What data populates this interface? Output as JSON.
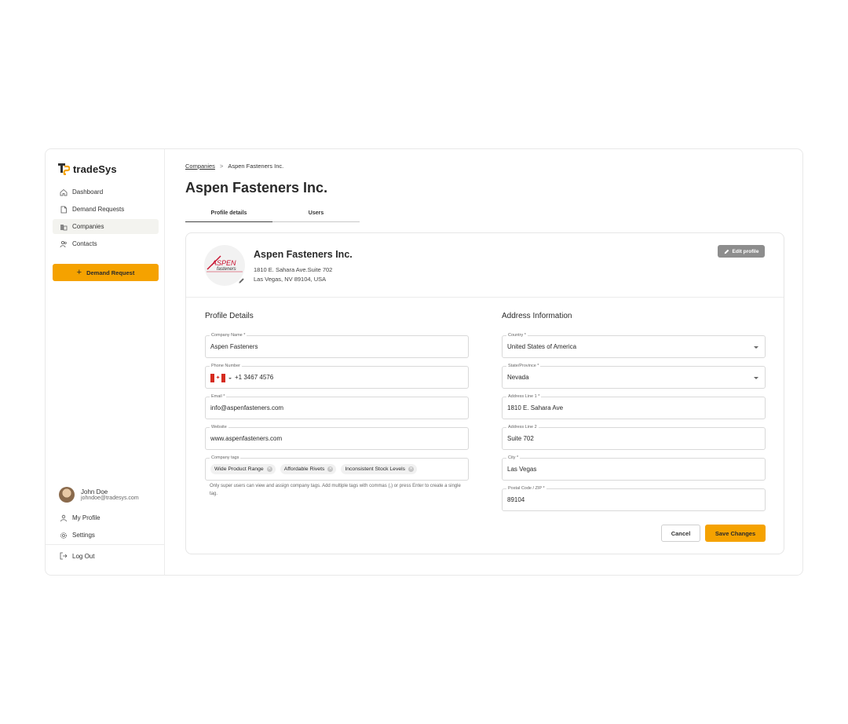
{
  "brand": {
    "name": "tradeSys",
    "accent": "#f5a200"
  },
  "sidebar": {
    "items": [
      {
        "label": "Dashboard",
        "icon": "home-icon"
      },
      {
        "label": "Demand Requests",
        "icon": "document-icon"
      },
      {
        "label": "Companies",
        "icon": "building-icon",
        "active": true
      },
      {
        "label": "Contacts",
        "icon": "users-icon"
      }
    ],
    "demand_button": "Demand Request",
    "user": {
      "name": "John Doe",
      "email": "johndoe@tradesys.com"
    },
    "bottom_items": [
      {
        "label": "My Profile",
        "icon": "user-icon"
      },
      {
        "label": "Settings",
        "icon": "gear-icon"
      }
    ],
    "logout": "Log Out"
  },
  "breadcrumb": {
    "parent": "Companies",
    "separator": ">",
    "current": "Aspen Fasteners Inc."
  },
  "page_title": "Aspen Fasteners Inc.",
  "tabs": [
    {
      "label": "Profile details",
      "active": true
    },
    {
      "label": "Users"
    }
  ],
  "company": {
    "name": "Aspen Fasteners Inc.",
    "address_line1": "1810 E. Sahara Ave.Suite 702",
    "address_line2": "Las Vegas, NV 89104, USA",
    "logo_text_top": "ASPEN",
    "logo_text_bottom": "fasteners",
    "edit_button": "Edit profile"
  },
  "profile": {
    "title": "Profile Details",
    "company_name": {
      "label": "Company Name *",
      "value": "Aspen Fasteners"
    },
    "phone": {
      "label": "Phone Number",
      "value": "+1 3467 4576"
    },
    "email": {
      "label": "Email *",
      "value": "info@aspenfasteners.com"
    },
    "website": {
      "label": "Website",
      "value": "www.aspenfasteners.com"
    },
    "tags": {
      "label": "Company tags",
      "items": [
        "Wide Product Range",
        "Affordable Rivets",
        "Inconsistent Stock Levels"
      ]
    },
    "help": "Only super users can view and assign company tags. Add multiple tags with commas (,) or press Enter to create a single tag."
  },
  "address": {
    "title": "Address Information",
    "country": {
      "label": "Country *",
      "value": "United States of America"
    },
    "state": {
      "label": "State/Province *",
      "value": "Nevada"
    },
    "line1": {
      "label": "Address Line 1 *",
      "value": "1810 E. Sahara Ave"
    },
    "line2": {
      "label": "Address Line 2",
      "value": "Suite 702"
    },
    "city": {
      "label": "City *",
      "value": "Las Vegas"
    },
    "postal": {
      "label": "Postal Code / ZIP *",
      "value": "89104"
    }
  },
  "actions": {
    "cancel": "Cancel",
    "save": "Save Changes"
  }
}
